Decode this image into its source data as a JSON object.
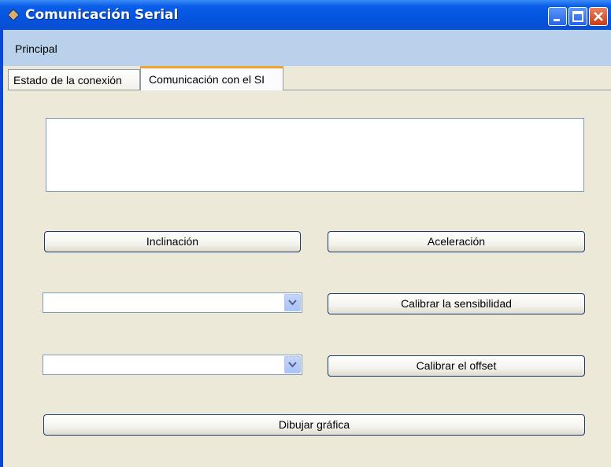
{
  "window": {
    "title": "Comunicación Serial"
  },
  "menu": {
    "items": [
      "Principal"
    ]
  },
  "tabs": [
    {
      "label": "Estado de la conexión",
      "active": false
    },
    {
      "label": "Comunicación con el SI",
      "active": true
    }
  ],
  "main": {
    "output_text": "",
    "buttons": {
      "inclinacion": "Inclinación",
      "aceleracion": "Aceleración",
      "calibrar_sensibilidad": "Calibrar la sensibilidad",
      "calibrar_offset": "Calibrar el offset",
      "dibujar_grafica": "Dibujar gráfica"
    },
    "sensitivity_select": {
      "selected": ""
    },
    "offset_select": {
      "selected": ""
    }
  },
  "icons": {
    "app": "app-diamond-icon",
    "minimize": "minimize-icon",
    "maximize": "maximize-icon",
    "close": "close-icon",
    "dropdown": "chevron-down-icon"
  },
  "colors": {
    "titlebar": "#0454e0",
    "menubar": "#b9d1ea",
    "panel": "#ece9d8",
    "active_tab_accent": "#f7a12c",
    "close_button": "#c83d16"
  }
}
